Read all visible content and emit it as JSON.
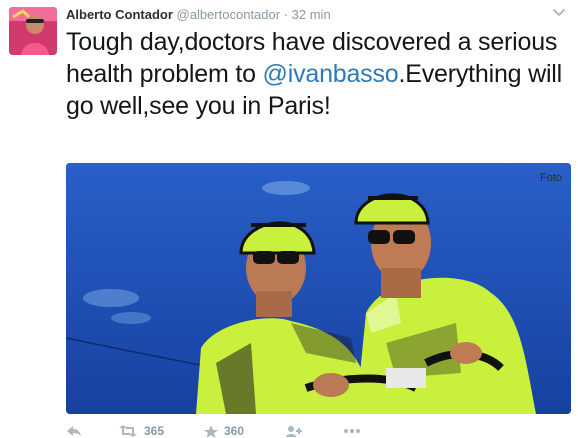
{
  "tweet": {
    "author_name": "Alberto Contador",
    "author_handle": "@albertocontador",
    "separator": "·",
    "time": "32 min",
    "text_before": "Tough day,doctors have discovered a serious health problem to ",
    "mention": "@ivanbasso",
    "text_after": ".Everything will go well,see you in Paris!",
    "photo_label": "Foto"
  },
  "actions": {
    "retweet_count": "365",
    "favorite_count": "360"
  },
  "colors": {
    "mention": "#2b7bb9",
    "secondary": "#8899a6",
    "jersey": "#c8f03c",
    "sky": "#1e50b8"
  }
}
